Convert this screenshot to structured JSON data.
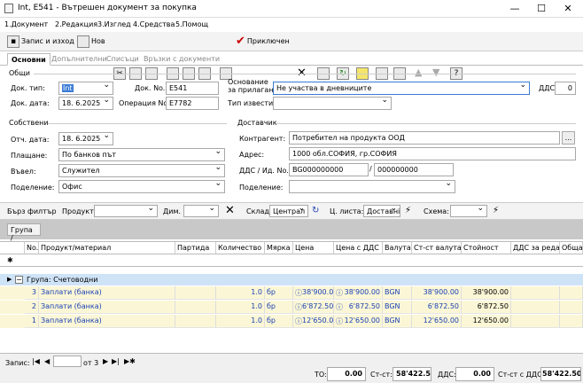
{
  "window": {
    "title": "Int, E541 - Вътрешен документ за покупка",
    "minimize": "—",
    "maximize": "☐",
    "close": "✕"
  },
  "menu": [
    "1.Документ",
    "2.Редакция",
    "3.Изглед",
    "4.Средства",
    "5.Помощ"
  ],
  "toolbar": {
    "save_close": "Запис и изход",
    "new": "Нов",
    "post": "Приключен"
  },
  "tabs": [
    "Основни",
    "Допълнителни",
    "Списъци",
    "Връзки с документи"
  ],
  "general": {
    "section": "Общи",
    "doc_type_label": "Док. тип:",
    "doc_type": "Int",
    "doc_no_label": "Док. No.",
    "doc_no": "E541",
    "basis_label1": "Основание",
    "basis_label2": "за прилагане:",
    "basis": "Не участва в дневниците",
    "vat_label": "ДДС:",
    "vat": "0",
    "doc_date_label": "Док. дата:",
    "doc_date": "18. 6.2025",
    "operation_label": "Операция No.",
    "operation": "E7782",
    "notice_label": "Тип известие:",
    "notice": ""
  },
  "own": {
    "section": "Собствени",
    "rep_date_label": "Отч. дата:",
    "rep_date": "18. 6.2025",
    "payment_label": "Плащане:",
    "payment": "По банков път",
    "entered_label": "Въвел:",
    "entered": "Служител",
    "division_label": "Поделение:",
    "division": "Офис"
  },
  "supplier": {
    "section": "Доставчик",
    "contractor_label": "Контрагент:",
    "contractor": "Потребител на продукта ООД",
    "more": "...",
    "address_label": "Адрес:",
    "address": "1000 обл.СОФИЯ, гр.СОФИЯ",
    "vat_id_label": "ДДС / Ид. No.",
    "vat_no": "BG000000000",
    "sep": "/",
    "id_no": "000000000",
    "division_label": "Поделение:",
    "division": ""
  },
  "filter": {
    "quick_filter": "Бърз филтър",
    "product_label": "Продукт:",
    "dim_label": "Дим.",
    "warehouse_label": "Склад:",
    "warehouse": "Централ",
    "price_list_label": "Ц. листа:",
    "price_list": "Доставні",
    "scheme_label": "Схема:"
  },
  "group_bar": {
    "label": "Група",
    "slash": "/"
  },
  "columns": [
    "No.",
    "Продукт/материал",
    "Партида",
    "Количество",
    "Мярка",
    "Цена",
    "Цена с ДДС",
    "Валута",
    "Ст-ст валута",
    "Стойност",
    "ДДС за реда",
    "Обща"
  ],
  "group_row": {
    "toggle": "−",
    "label": "Група: Счетоводни"
  },
  "rows": [
    {
      "no": "3",
      "product": "Заплати (банка)",
      "qty": "1.0",
      "unit": "бр",
      "price": "38'900.00",
      "price_vat": "38'900.00",
      "currency": "BGN",
      "value_cur": "38'900.00",
      "value": "38'900.00"
    },
    {
      "no": "2",
      "product": "Заплати (банка)",
      "qty": "1.0",
      "unit": "бр",
      "price": "6'872.50",
      "price_vat": "6'872.50",
      "currency": "BGN",
      "value_cur": "6'872.50",
      "value": "6'872.50"
    },
    {
      "no": "1",
      "product": "Заплати (банка)",
      "qty": "1.0",
      "unit": "бр",
      "price": "12'650.00",
      "price_vat": "12'650.00",
      "currency": "BGN",
      "value_cur": "12'650.00",
      "value": "12'650.00"
    }
  ],
  "status": {
    "records_label": "Запис:",
    "of": "от 3",
    "to_label": "ТО:",
    "to": "0.00",
    "cost_label": "Ст-ст:",
    "cost": "58'422.50",
    "vat_label": "ДДС:",
    "vat": "0.00",
    "cost_vat_label": "Ст-ст с ДДС:",
    "cost_vat": "58'422.50"
  }
}
